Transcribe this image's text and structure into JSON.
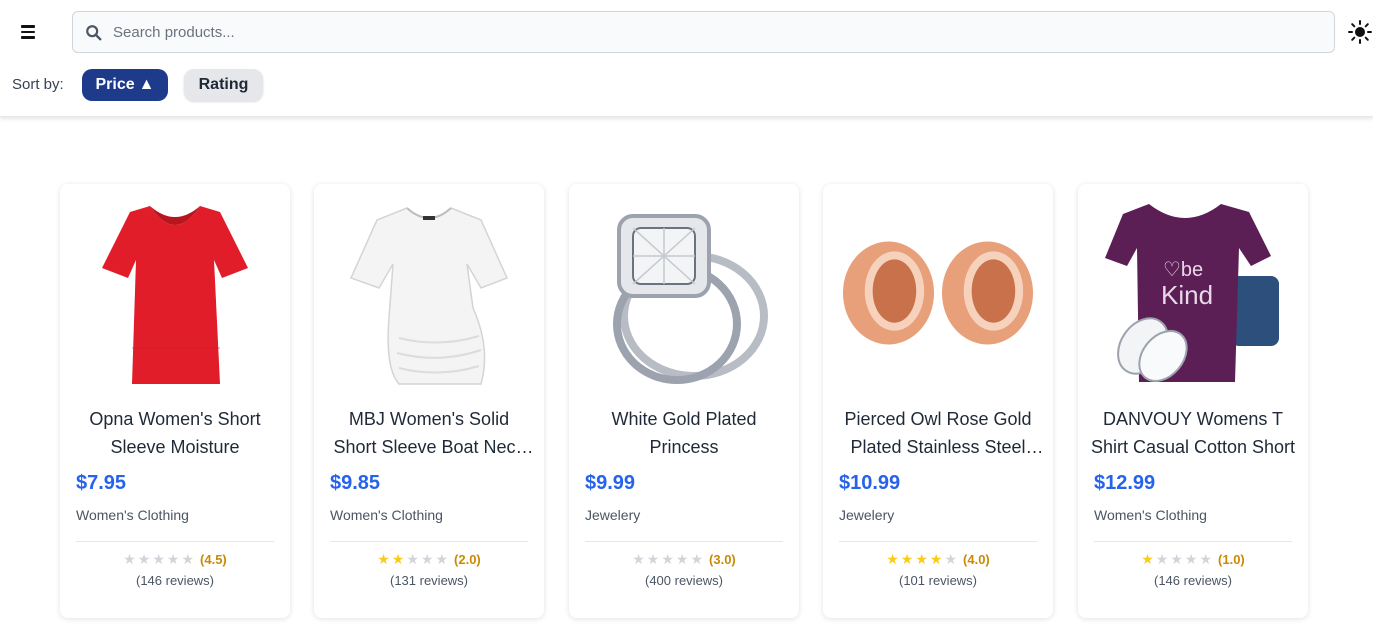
{
  "header": {
    "search_placeholder": "Search products...",
    "sort_label": "Sort by:",
    "sort_price_label": "Price",
    "sort_price_arrow": "▲",
    "sort_rating_label": "Rating"
  },
  "colors": {
    "accent": "#1e3a8a",
    "price": "#2563eb",
    "star": "#facc15",
    "rating_text": "#ca8a04"
  },
  "products": [
    {
      "title": "Opna Women's Short Sleeve Moisture",
      "price": "$7.95",
      "category": "Women's Clothing",
      "rating": 4.5,
      "rating_text": "(4.5)",
      "reviews": "(146 reviews)",
      "filled_stars": 0,
      "image_icon": "red-tshirt-image"
    },
    {
      "title": "MBJ Women's Solid Short Sleeve Boat Neck V",
      "price": "$9.85",
      "category": "Women's Clothing",
      "rating": 2.0,
      "rating_text": "(2.0)",
      "reviews": "(131 reviews)",
      "filled_stars": 2,
      "image_icon": "white-top-image"
    },
    {
      "title": "White Gold Plated Princess",
      "price": "$9.99",
      "category": "Jewelery",
      "rating": 3.0,
      "rating_text": "(3.0)",
      "reviews": "(400 reviews)",
      "filled_stars": 0,
      "image_icon": "diamond-ring-image"
    },
    {
      "title": "Pierced Owl Rose Gold Plated Stainless Steel Double",
      "price": "$10.99",
      "category": "Jewelery",
      "rating": 4.0,
      "rating_text": "(4.0)",
      "reviews": "(101 reviews)",
      "filled_stars": 4,
      "image_icon": "rose-gold-plugs-image"
    },
    {
      "title": "DANVOUY Womens T Shirt Casual Cotton Short",
      "price": "$12.99",
      "category": "Women's Clothing",
      "rating": 1.0,
      "rating_text": "(1.0)",
      "reviews": "(146 reviews)",
      "filled_stars": 1,
      "image_icon": "purple-be-kind-shirt-image"
    }
  ]
}
